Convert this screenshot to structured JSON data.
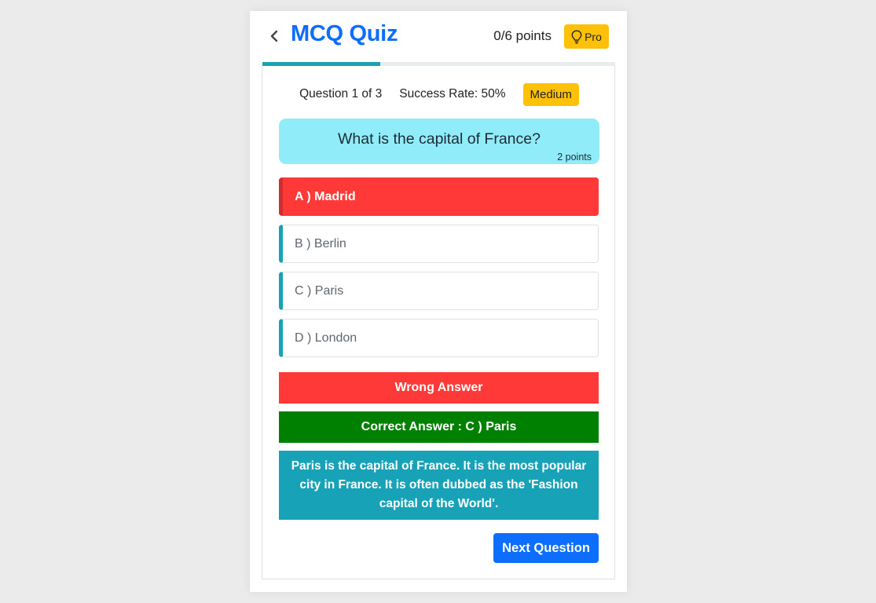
{
  "header": {
    "title": "MCQ Quiz",
    "points": "0/6 points",
    "pro_label": "Pro",
    "back_icon": "chevron-left-icon",
    "pro_icon": "lightbulb-icon"
  },
  "progress": {
    "fraction": 0.3333
  },
  "meta": {
    "question_number": "Question 1 of 3",
    "success_rate": "Success Rate: 50%",
    "difficulty": "Medium"
  },
  "question": {
    "text": "What is the capital of France?",
    "points": "2 points"
  },
  "options": [
    {
      "label": "A ) Madrid",
      "state": "wrong"
    },
    {
      "label": "B ) Berlin",
      "state": "normal"
    },
    {
      "label": "C ) Paris",
      "state": "normal"
    },
    {
      "label": "D ) London",
      "state": "normal"
    }
  ],
  "result": {
    "wrong_text": "Wrong Answer",
    "correct_text": "Correct Answer : C ) Paris",
    "explanation": "Paris is the capital of France. It is the most popular city in France. It is often dubbed as the 'Fashion capital of the World'."
  },
  "next_button": "Next Question",
  "colors": {
    "accent": "#0d6efd",
    "warning": "#ffc107",
    "info": "#17a2b8",
    "danger": "#ff3838",
    "success": "#008000",
    "question_bg": "#91ecfa"
  }
}
